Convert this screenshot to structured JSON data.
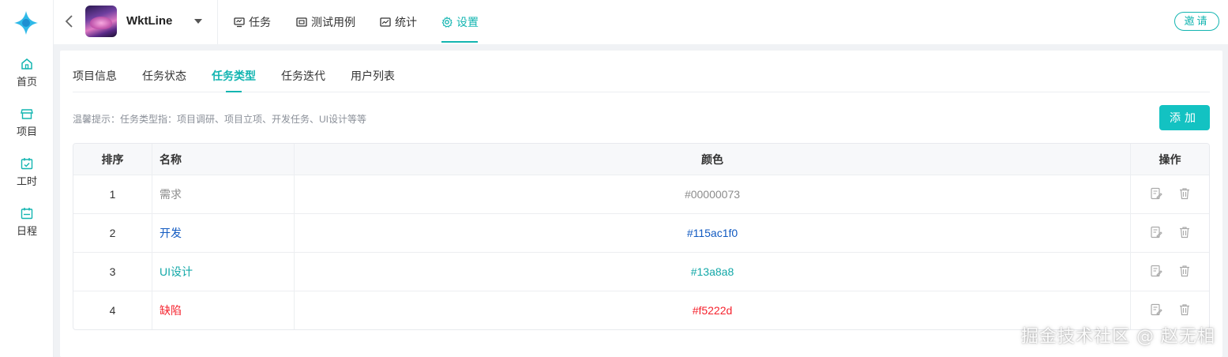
{
  "rail": {
    "items": [
      {
        "label": "首页",
        "icon": "home-icon"
      },
      {
        "label": "项目",
        "icon": "store-icon"
      },
      {
        "label": "工时",
        "icon": "calendar-check-icon"
      },
      {
        "label": "日程",
        "icon": "calendar-icon"
      }
    ]
  },
  "topbar": {
    "project_name": "WktLine",
    "tabs": [
      {
        "label": "任务",
        "icon": "monitor-icon"
      },
      {
        "label": "测试用例",
        "icon": "test-case-icon"
      },
      {
        "label": "统计",
        "icon": "chart-icon"
      },
      {
        "label": "设置",
        "icon": "gear-icon"
      }
    ],
    "invite_label": "邀请"
  },
  "subtabs": [
    "项目信息",
    "任务状态",
    "任务类型",
    "任务迭代",
    "用户列表"
  ],
  "tip": "温馨提示：任务类型指：项目调研、项目立项、开发任务、UI设计等等",
  "add_label": "添加",
  "table": {
    "headers": {
      "idx": "排序",
      "name": "名称",
      "color": "颜色",
      "ops": "操作"
    },
    "rows": [
      {
        "idx": "1",
        "name": "需求",
        "color": "#00000073",
        "text_color": "#8c8c8c"
      },
      {
        "idx": "2",
        "name": "开发",
        "color": "#115ac1f0",
        "text_color": "#115ac1"
      },
      {
        "idx": "3",
        "name": "UI设计",
        "color": "#13a8a8",
        "text_color": "#13a8a8"
      },
      {
        "idx": "4",
        "name": "缺陷",
        "color": "#f5222d",
        "text_color": "#f5222d"
      }
    ]
  },
  "watermark": "掘金技术社区 @ 赵无相",
  "accent": "#13b5b1"
}
